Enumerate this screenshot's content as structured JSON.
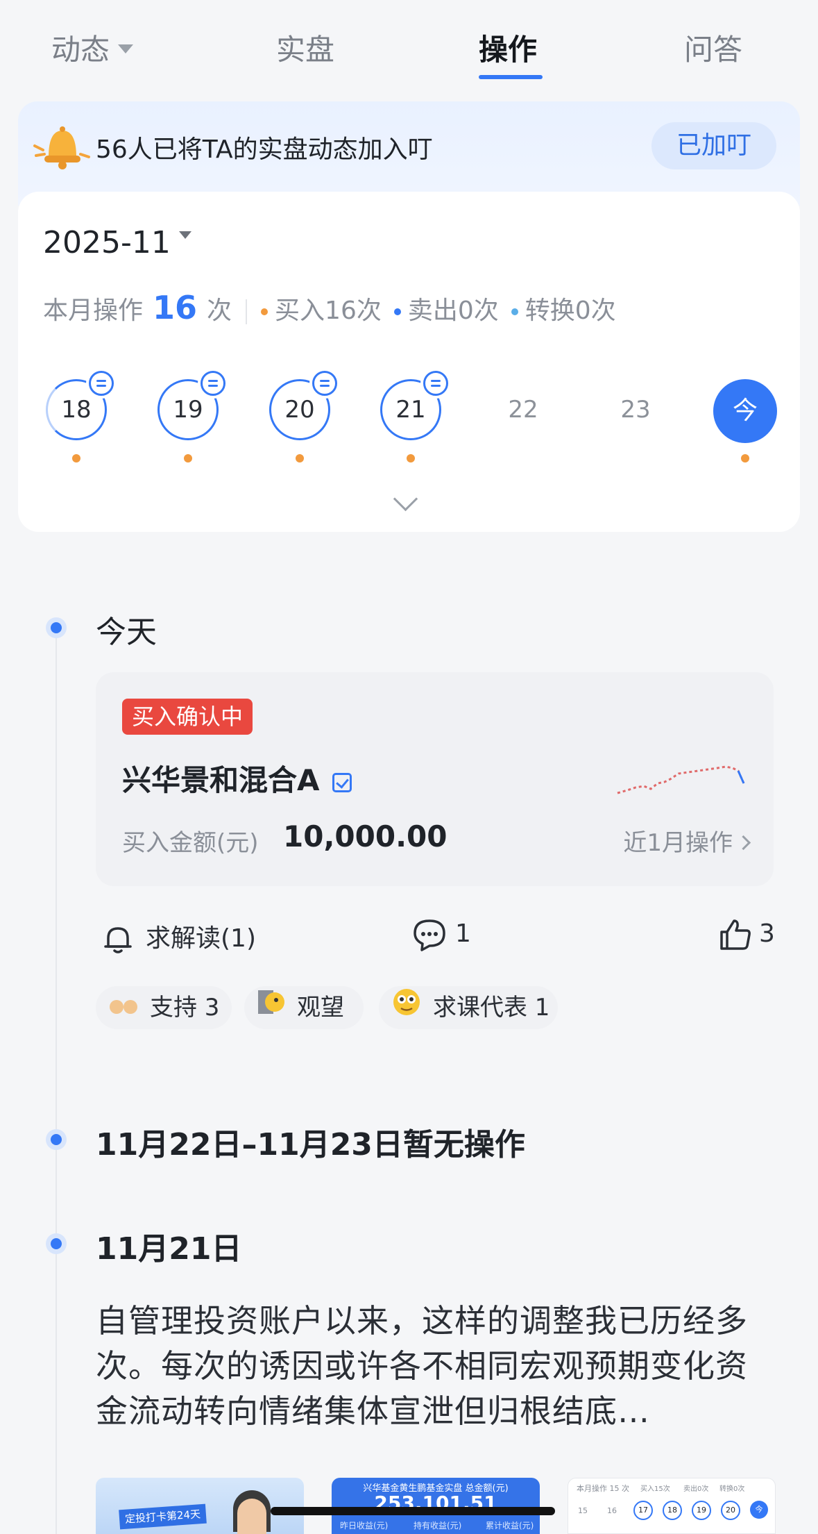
{
  "tabs": [
    {
      "label": "动态"
    },
    {
      "label": "实盘"
    },
    {
      "label": "操作"
    },
    {
      "label": "问答"
    }
  ],
  "banner": {
    "text": "56人已将TA的实盘动态加入叮",
    "button": "已加叮"
  },
  "calendar": {
    "month": "2025-11",
    "stats_prefix": "本月操作",
    "stats_count": "16",
    "stats_unit": "次",
    "buy": "买入16次",
    "sell": "卖出0次",
    "convert": "转换0次",
    "days": [
      "18",
      "19",
      "20",
      "21",
      "22",
      "23",
      "今"
    ]
  },
  "colors": {
    "accent": "#3478f6",
    "buy_dot": "#f29a3d",
    "sell_dot": "#3478f6",
    "convert_dot": "#5aaee8",
    "tag_red": "#e9483f"
  },
  "timeline": {
    "today_title": "今天",
    "status_tag": "买入确认中",
    "fund_name": "兴华景和混合A",
    "amount_label": "买入金额(元)",
    "amount": "10,000.00",
    "recent_link": "近1月操作",
    "actions": {
      "ask": "求解读(1)",
      "comments": "1",
      "likes": "3"
    },
    "reactions": [
      {
        "label": "支持 3",
        "icon": "clap-icon"
      },
      {
        "label": "观望",
        "icon": "peek-icon"
      },
      {
        "label": "求课代表 1",
        "icon": "star-eyes-icon"
      }
    ],
    "no_op_title": "11月22日–11月23日暂无操作",
    "nov21_title": "11月21日",
    "nov21_text": "自管理投资账户以来，这样的调整我已历经多次。每次的诱因或许各不相同宏观预期变化资金流动转向情绪集体宣泄但归根结底…",
    "thumbs": [
      {
        "text": "定投打卡第24天"
      },
      {
        "text": "兴华基金黄生鹏基金实盘 总金额(元)",
        "value": "253,101.51",
        "sub1": "昨日收益(元)",
        "sub2": "持有收益(元)",
        "sub3": "累计收益(元)"
      },
      {
        "text": "本月操作 15 次",
        "sub1": "买入15次",
        "sub2": "卖出0次",
        "sub3": "转换0次",
        "days": [
          "15",
          "16",
          "17",
          "18",
          "19",
          "20",
          "今"
        ]
      }
    ]
  }
}
